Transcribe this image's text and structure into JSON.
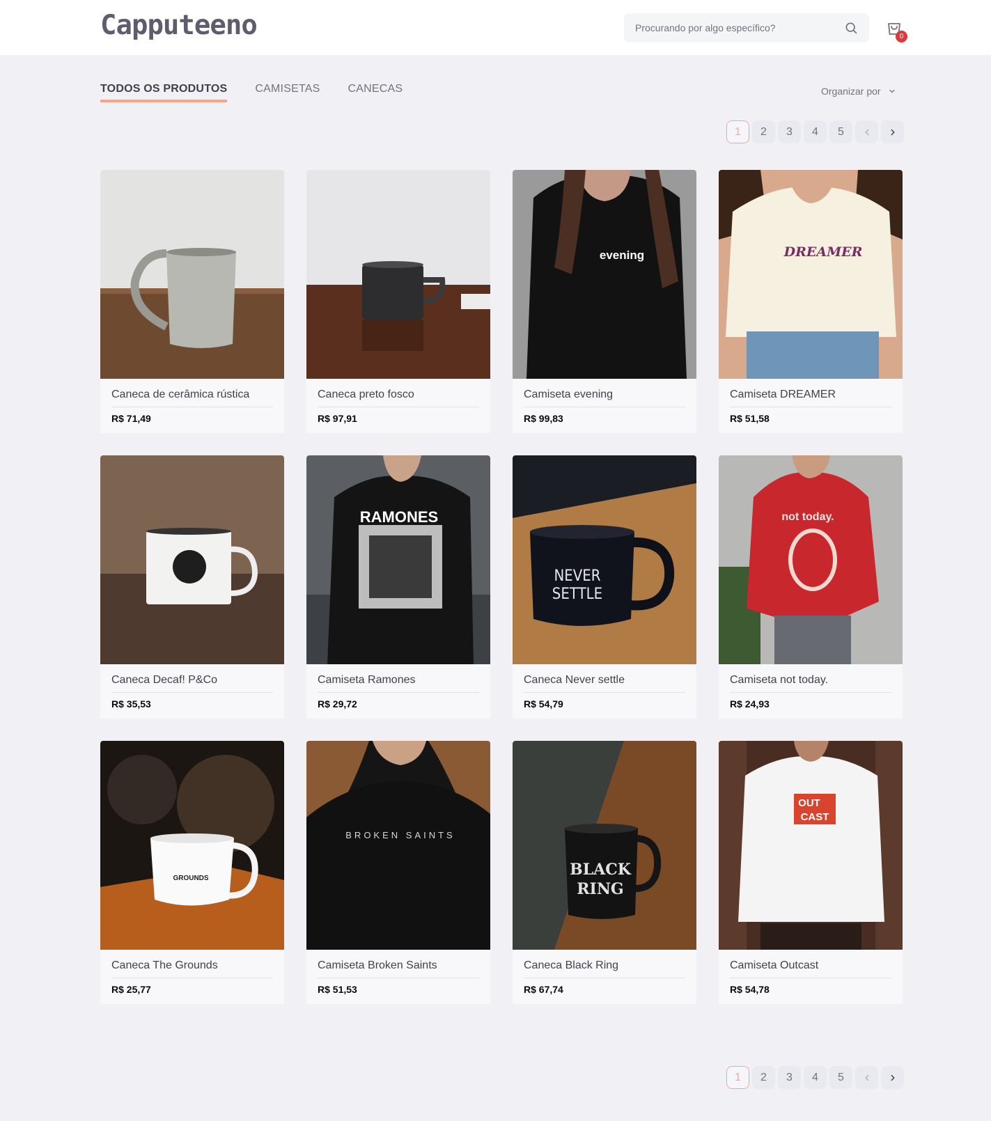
{
  "header": {
    "logo": "Capputeeno",
    "search_placeholder": "Procurando por algo específico?",
    "cart_count": "0"
  },
  "tabs": [
    {
      "label": "TODOS OS PRODUTOS",
      "active": true
    },
    {
      "label": "CAMISETAS",
      "active": false
    },
    {
      "label": "CANECAS",
      "active": false
    }
  ],
  "sort": {
    "label": "Organizar por"
  },
  "pagination": {
    "pages": [
      "1",
      "2",
      "3",
      "4",
      "5"
    ],
    "current": "1"
  },
  "colors": {
    "accent": "#ffa585",
    "badge": "#de3838",
    "background": "#f0f0f5"
  },
  "products": [
    {
      "name": "Caneca de cerâmica rústica",
      "price": "R$ 71,49"
    },
    {
      "name": "Caneca preto fosco",
      "price": "R$ 97,91"
    },
    {
      "name": "Camiseta evening",
      "price": "R$ 99,83"
    },
    {
      "name": "Camiseta DREAMER",
      "price": "R$ 51,58"
    },
    {
      "name": "Caneca Decaf! P&Co",
      "price": "R$ 35,53"
    },
    {
      "name": "Camiseta Ramones",
      "price": "R$ 29,72"
    },
    {
      "name": "Caneca Never settle",
      "price": "R$ 54,79"
    },
    {
      "name": "Camiseta not today.",
      "price": "R$ 24,93"
    },
    {
      "name": "Caneca The Grounds",
      "price": "R$ 25,77"
    },
    {
      "name": "Camiseta Broken Saints",
      "price": "R$ 51,53"
    },
    {
      "name": "Caneca Black Ring",
      "price": "R$ 67,74"
    },
    {
      "name": "Camiseta Outcast",
      "price": "R$ 54,78"
    }
  ],
  "image_text": {
    "evening": "evening",
    "dreamer": "DREAMER",
    "ramones": "RAMONES",
    "never": "NEVER",
    "settle": "SETTLE",
    "not_today": "not today.",
    "grounds": "GROUNDS",
    "broken_saints": "BROKEN SAINTS",
    "black": "BLACK",
    "ring": "RING",
    "out": "OUT",
    "cast": "CAST"
  }
}
